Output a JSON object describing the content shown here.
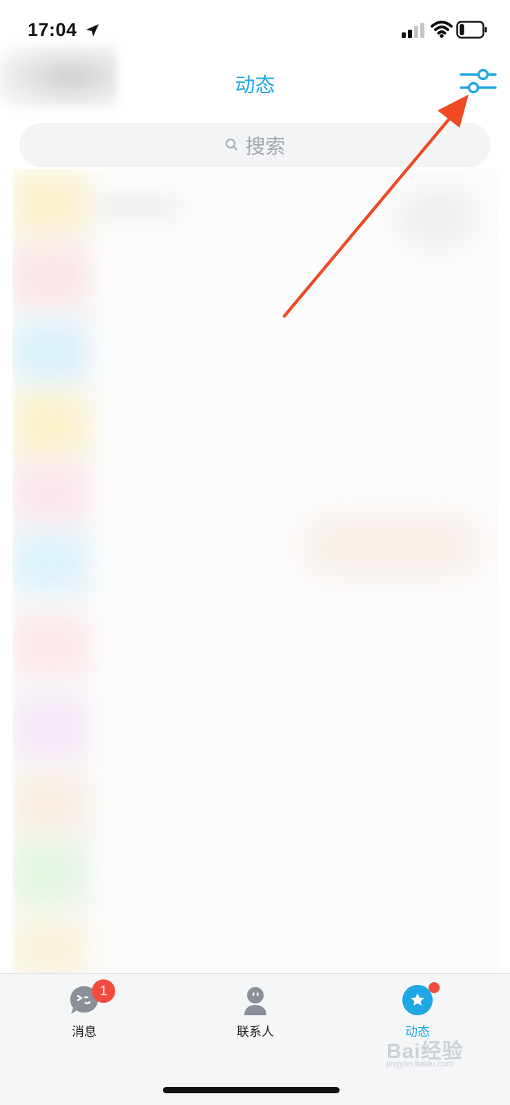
{
  "status_bar": {
    "time": "17:04",
    "location_icon": "location-arrow-icon",
    "signal_icon": "cellular-signal-icon",
    "wifi_icon": "wifi-icon",
    "battery_icon": "battery-icon",
    "battery_level": 0.2
  },
  "header": {
    "title": "动态",
    "filter_icon": "sliders-filter-icon"
  },
  "search": {
    "label": "搜索",
    "icon": "search-icon"
  },
  "tabs": [
    {
      "label": "消息",
      "icon": "message-bubble-icon",
      "badge": "1",
      "active": false
    },
    {
      "label": "联系人",
      "icon": "contact-person-icon",
      "active": false
    },
    {
      "label": "动态",
      "icon": "star-circle-icon",
      "active": true,
      "dot": true
    }
  ],
  "watermark": {
    "main": "Bai经验",
    "sub": "jingyan.baidu.com"
  },
  "colors": {
    "accent": "#20a7e6",
    "badge": "#f34c3f",
    "annotation": "#f04a24",
    "tab_icon_inactive": "#8a8f99"
  }
}
